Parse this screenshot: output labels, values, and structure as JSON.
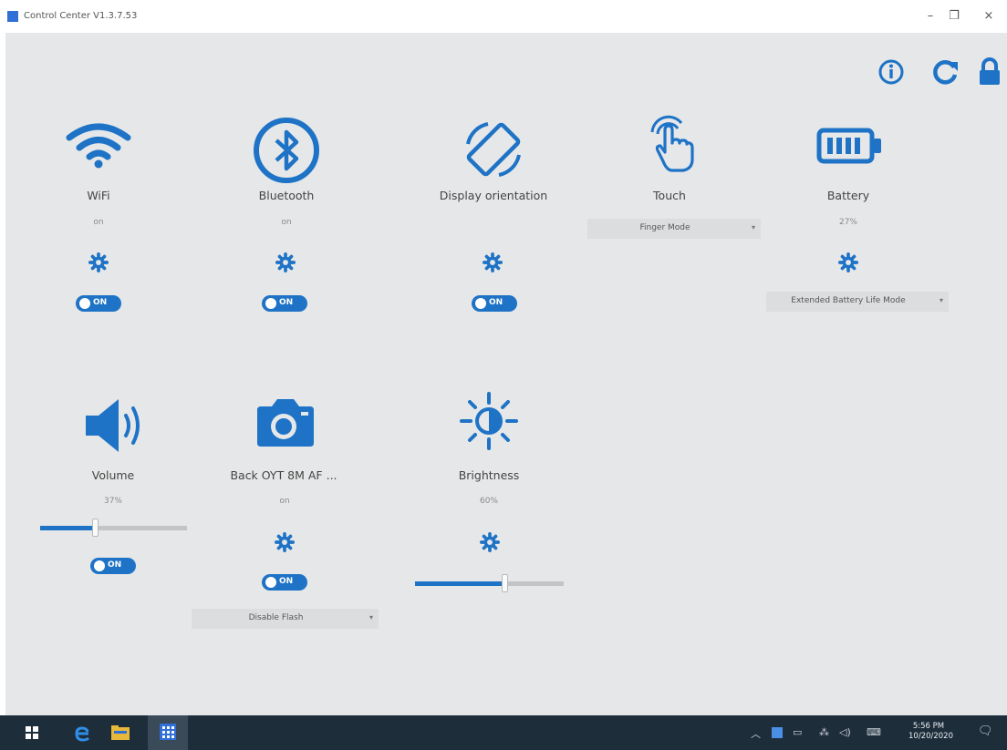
{
  "window": {
    "title": "Control Center V1.3.7.53",
    "minimize_glyph": "–",
    "maximize_glyph": "❐",
    "close_glyph": "×"
  },
  "header_icons": [
    "info-icon",
    "refresh-icon",
    "lock-icon"
  ],
  "accent": "#1e73c6",
  "tiles": {
    "wifi": {
      "label": "WiFi",
      "status": "on",
      "toggle": "ON",
      "icon": "wifi-icon"
    },
    "bluetooth": {
      "label": "Bluetooth",
      "status": "on",
      "toggle": "ON",
      "icon": "bluetooth-icon"
    },
    "display": {
      "label": "Display orientation",
      "toggle": "ON",
      "icon": "rotate-screen-icon"
    },
    "touch": {
      "label": "Touch",
      "mode": "Finger Mode",
      "icon": "touch-hand-icon"
    },
    "battery": {
      "label": "Battery",
      "level": "27%",
      "mode": "Extended Battery Life Mode",
      "icon": "battery-icon"
    },
    "volume": {
      "label": "Volume",
      "level": "37%",
      "level_value": 0.37,
      "toggle": "ON",
      "icon": "speaker-icon"
    },
    "camera": {
      "label": "Back OYT 8M AF ...",
      "status": "on",
      "toggle": "ON",
      "flash": "Disable Flash",
      "icon": "camera-icon"
    },
    "brightness": {
      "label": "Brightness",
      "level": "60%",
      "level_value": 0.6,
      "icon": "brightness-icon"
    }
  },
  "taskbar": {
    "icons": [
      "windows-start-icon",
      "edge-icon",
      "file-explorer-icon",
      "control-center-app-icon"
    ],
    "time": "5:56 PM",
    "date": "10/20/2020"
  }
}
